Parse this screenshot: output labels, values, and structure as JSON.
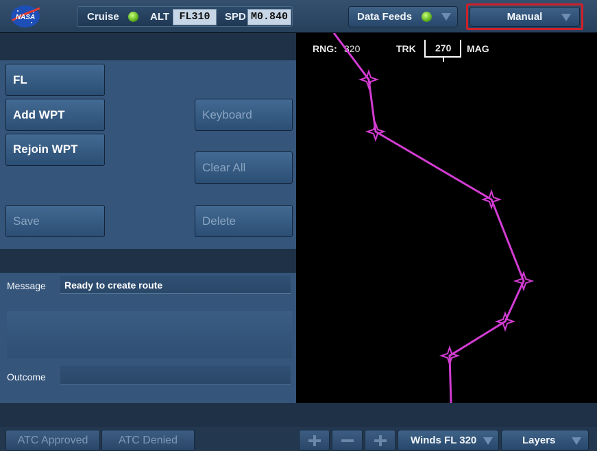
{
  "header": {
    "logo_text": "NASA",
    "phase_label": "Cruise",
    "alt_label": "ALT",
    "alt_value": "FL310",
    "spd_label": "SPD",
    "spd_value": "M0.840",
    "data_feeds_label": "Data Feeds",
    "mode_label": "Manual",
    "status_color": "#5fb31f",
    "highlight_color": "#d0202a"
  },
  "left_panel": {
    "buttons": {
      "fl": "FL",
      "add_wpt": "Add WPT",
      "rejoin_wpt": "Rejoin WPT",
      "save": "Save",
      "keyboard": "Keyboard",
      "clear_all": "Clear All",
      "delete": "Delete"
    },
    "message_label": "Message",
    "message_value": "Ready to create route",
    "outcome_label": "Outcome",
    "outcome_value": ""
  },
  "map": {
    "rng_label": "RNG:",
    "rng_value": "320",
    "trk_label": "TRK",
    "trk_value": "270",
    "mag_label": "MAG",
    "route_color": "#d23cd2",
    "waypoint_icon": "four-point-star-icon"
  },
  "bottom": {
    "atc_approved": "ATC Approved",
    "atc_denied": "ATC Denied",
    "winds_label": "Winds FL 320",
    "layers_label": "Layers"
  }
}
